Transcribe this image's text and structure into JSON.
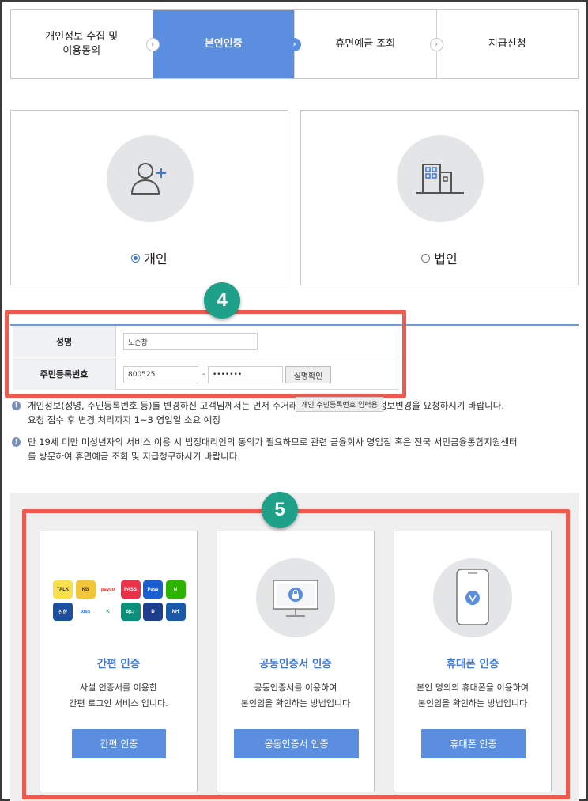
{
  "steps": [
    {
      "label": "개인정보 수집 및\n이용동의",
      "active": false
    },
    {
      "label": "본인인증",
      "active": true
    },
    {
      "label": "휴면예금 조회",
      "active": false
    },
    {
      "label": "지급신청",
      "active": false
    }
  ],
  "types": {
    "personal": {
      "label": "개인",
      "selected": true,
      "icon": "person-plus-icon"
    },
    "corporate": {
      "label": "법인",
      "selected": false,
      "icon": "building-icon"
    }
  },
  "badges": {
    "form": "4",
    "auth": "5"
  },
  "form": {
    "name_label": "성명",
    "name_value": "노순창",
    "rrn_label": "주민등록번호",
    "rrn_front": "800525",
    "rrn_separator": "-",
    "rrn_back": "•••••••",
    "verify_button": "실명확인",
    "tooltip": "개인 주민등록번호 입력용"
  },
  "notices": [
    {
      "text": "개인정보(성명, 주민등록번호 등)를 변경하신 고객님께서는 먼저 주거래금융회사에 방문하여 정보변경을 요청하시기 바랍니다.\n요청 접수 후 변경 처리까지 1~3 영업일 소요 예정"
    },
    {
      "text": "만 19세 미만 미성년자의 서비스 이용 시 법정대리인의 동의가 필요하므로 관련 금융회사 영업점 혹은 전국 서민금융통합지원센터\n를 방문하여 휴면예금 조회 및 지급청구하시기 바랍니다."
    }
  ],
  "auth_methods": [
    {
      "title": "간편 인증",
      "desc": "사설 인증서를 이용한\n간편 로그인 서비스 입니다.",
      "button": "간편 인증",
      "icon": "app-logos-icon"
    },
    {
      "title": "공동인증서 인증",
      "desc": "공동인증서를 이용하여\n본인임을 확인하는 방법입니다",
      "button": "공동인증서 인증",
      "icon": "monitor-lock-icon"
    },
    {
      "title": "휴대폰 인증",
      "desc": "본인 명의의 휴대폰을 이용하여\n본인임을 확인하는 방법입니다",
      "button": "휴대폰 인증",
      "icon": "smartphone-check-icon"
    }
  ],
  "app_logos": [
    {
      "label": "TALK",
      "bg": "#f7e04b",
      "fg": "#3b2a1a"
    },
    {
      "label": "KB",
      "bg": "#f2c63a",
      "fg": "#4a3a1a"
    },
    {
      "label": "payco",
      "bg": "#ffffff",
      "fg": "#e2352b"
    },
    {
      "label": "PASS",
      "bg": "#e8334a",
      "fg": "#ffffff"
    },
    {
      "label": "Pass",
      "bg": "#1a5fd0",
      "fg": "#ffffff"
    },
    {
      "label": "N",
      "bg": "#2db400",
      "fg": "#ffffff"
    },
    {
      "label": "신한",
      "bg": "#1d4f9f",
      "fg": "#ffffff"
    },
    {
      "label": "toss",
      "bg": "#ffffff",
      "fg": "#2b6ff3"
    },
    {
      "label": "K",
      "bg": "#ffffff",
      "fg": "#2aa58a"
    },
    {
      "label": "하나",
      "bg": "#0c8f7a",
      "fg": "#ffffff"
    },
    {
      "label": "D",
      "bg": "#1d3d8f",
      "fg": "#ffffff"
    },
    {
      "label": "NH",
      "bg": "#1c58a8",
      "fg": "#ffffff"
    }
  ],
  "colors": {
    "accent": "#5b8ede",
    "highlight": "#ee5a4f",
    "badge": "#1fa089"
  }
}
